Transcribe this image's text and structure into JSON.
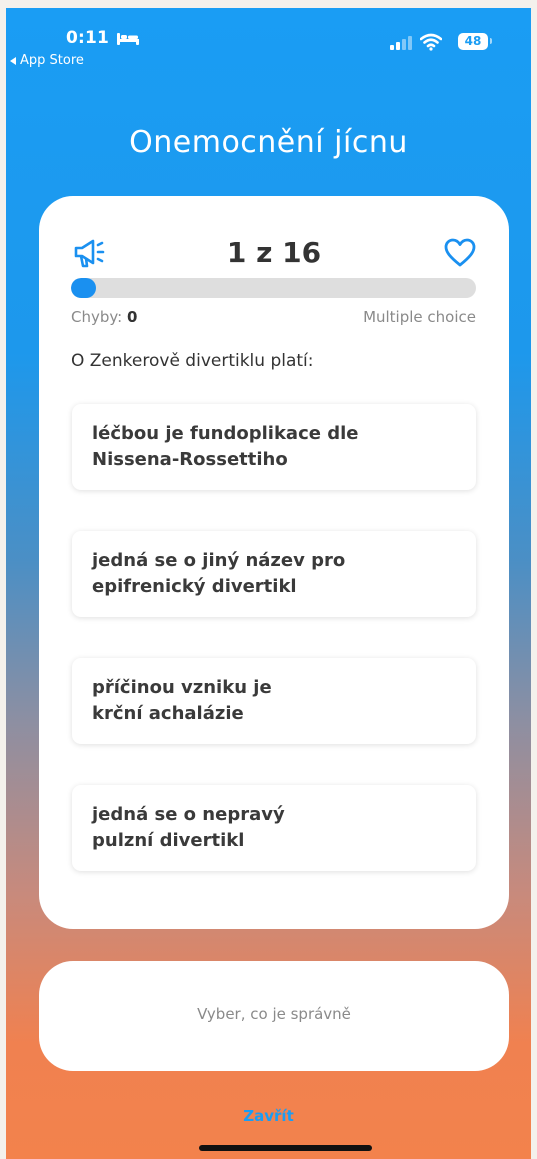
{
  "status_bar": {
    "time": "0:11",
    "back_app": "App Store",
    "battery": "48"
  },
  "title": "Onemocnění jícnu",
  "quiz": {
    "counter": "1 z 16",
    "progress": 0.0625,
    "errors_label": "Chyby:",
    "errors_count": "0",
    "question_type": "Multiple choice",
    "question": "O Zenkerově divertiklu platí:",
    "answers": [
      {
        "line1": "léčbou je fundoplikace dle",
        "line2": "Nissena-Rossettiho"
      },
      {
        "line1": "jedná se o jiný název pro",
        "line2": "epifrenický divertikl"
      },
      {
        "line1": "příčinou vzniku je",
        "line2": "krční achalázie"
      },
      {
        "line1": "jedná se o nepravý",
        "line2": "pulzní divertikl"
      }
    ]
  },
  "hint": "Vyber, co je správně",
  "close_label": "Zavřít",
  "colors": {
    "accent": "#1a9df4",
    "gradient_top": "#1a9df4",
    "gradient_bottom": "#f3824c"
  },
  "icons": {
    "speaker": "megaphone-icon",
    "favorite": "heart-icon",
    "sleep": "bed-icon",
    "signal": "signal-icon",
    "wifi": "wifi-icon"
  }
}
